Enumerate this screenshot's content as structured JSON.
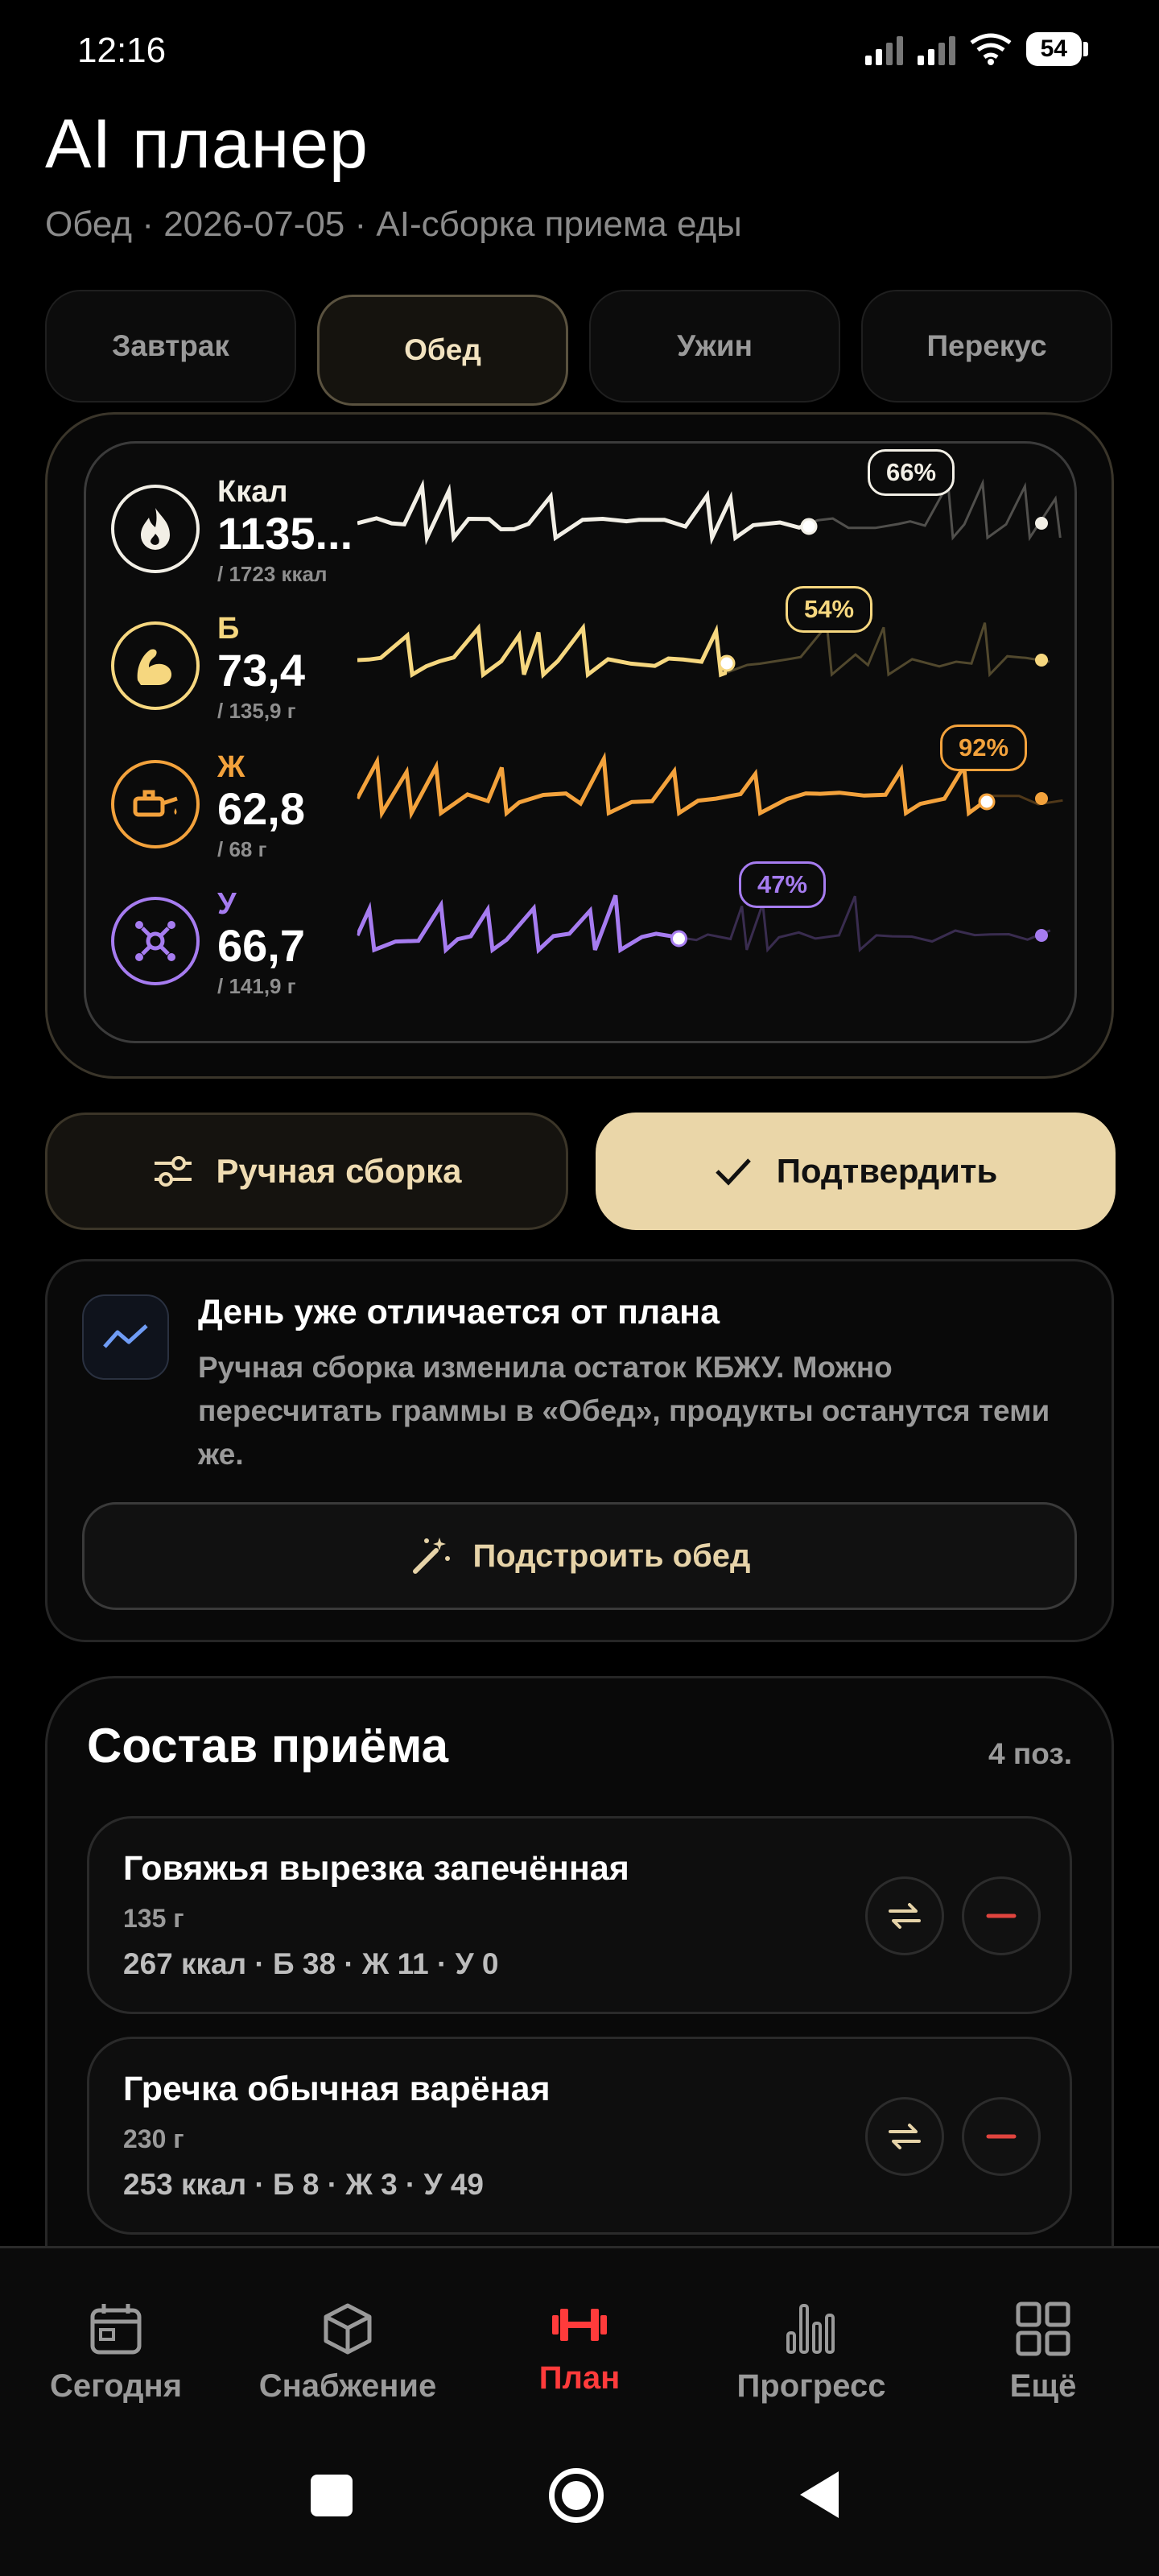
{
  "status": {
    "time": "12:16",
    "battery": "54"
  },
  "header": {
    "title": "AI планер",
    "subtitle": "Обед · 2026-07-05 · AI-сборка приема еды"
  },
  "tabs": [
    {
      "label": "Завтрак"
    },
    {
      "label": "Обед",
      "active": true
    },
    {
      "label": "Ужин"
    },
    {
      "label": "Перекус"
    }
  ],
  "macros": [
    {
      "label": "Ккал",
      "value": "1135...",
      "total": "/ 1723 ккал",
      "percent": "66%",
      "fraction": 0.66,
      "color": "#f2efe6",
      "icon": "flame-icon"
    },
    {
      "label": "Б",
      "value": "73,4",
      "total": "/ 135,9 г",
      "percent": "54%",
      "fraction": 0.54,
      "color": "#f6d77f",
      "icon": "muscle-icon"
    },
    {
      "label": "Ж",
      "value": "62,8",
      "total": "/ 68 г",
      "percent": "92%",
      "fraction": 0.92,
      "color": "#f3a23c",
      "icon": "oil-can-icon"
    },
    {
      "label": "У",
      "value": "66,7",
      "total": "/ 141,9 г",
      "percent": "47%",
      "fraction": 0.47,
      "color": "#a67cf0",
      "icon": "molecule-icon"
    }
  ],
  "actions": {
    "manual": "Ручная сборка",
    "confirm": "Подтвердить"
  },
  "notice": {
    "title": "День уже отличается от плана",
    "text": "Ручная сборка изменила остаток КБЖУ. Можно пересчитать граммы в «Обед», продукты останутся теми же.",
    "button": "Подстроить обед"
  },
  "composition": {
    "title": "Состав приёма",
    "count": "4 поз.",
    "items": [
      {
        "name": "Говяжья вырезка запечённая",
        "weight": "135 г",
        "macros": "267 ккал · Б 38 · Ж 11 · У 0"
      },
      {
        "name": "Гречка обычная варёная",
        "weight": "230 г",
        "macros": "253 ккал · Б 8 · Ж 3 · У 49"
      }
    ]
  },
  "nav": [
    {
      "label": "Сегодня",
      "icon": "calendar-icon"
    },
    {
      "label": "Снабжение",
      "icon": "box-icon"
    },
    {
      "label": "План",
      "icon": "dumbbell-icon",
      "active": true
    },
    {
      "label": "Прогресс",
      "icon": "bar-chart-icon"
    },
    {
      "label": "Ещё",
      "icon": "grid-icon"
    }
  ]
}
